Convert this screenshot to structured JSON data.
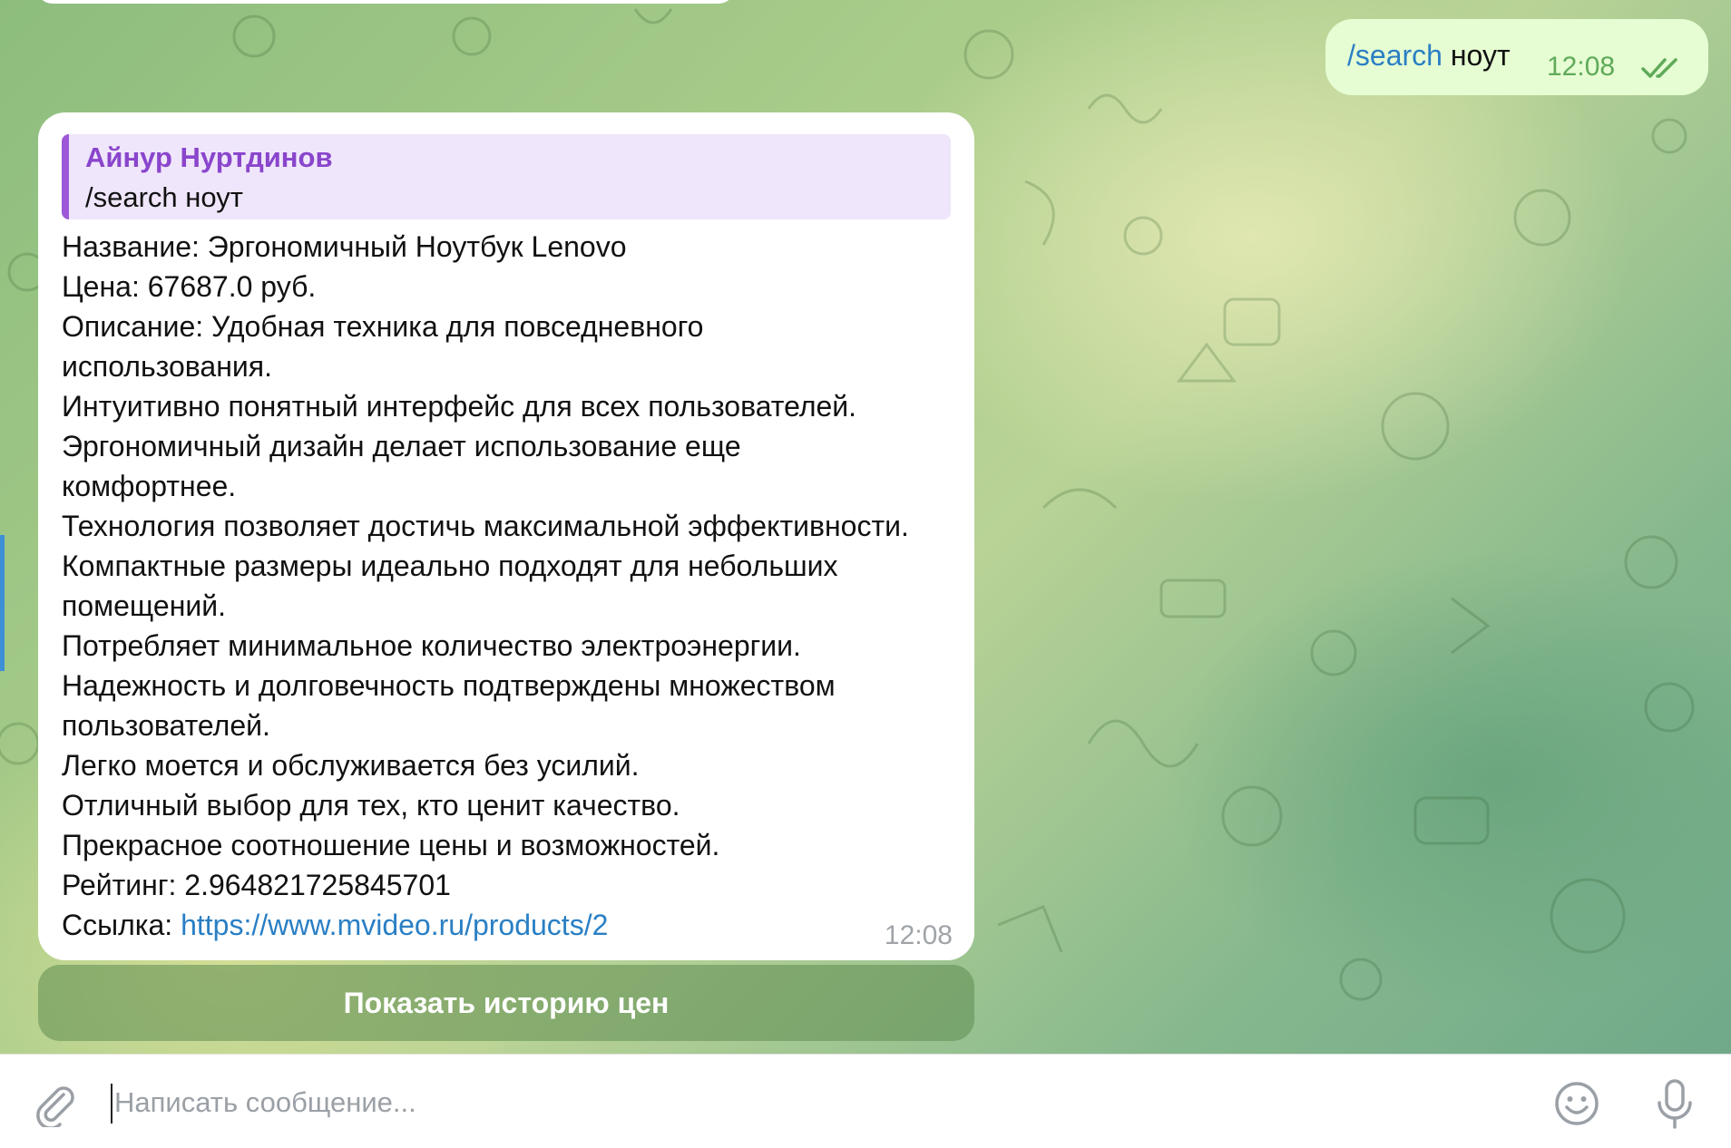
{
  "outgoing_message": {
    "command": "/search",
    "text": "ноут",
    "time": "12:08",
    "status_icon": "double-check-icon"
  },
  "incoming_message": {
    "reply": {
      "author": "Айнур Нуртдинов",
      "text": "/search ноут"
    },
    "lines": [
      "Название: Эргономичный Ноутбук Lenovo",
      "Цена: 67687.0 руб.",
      "Описание: Удобная техника для повседневного",
      "использования.",
      "Интуитивно понятный интерфейс для всех пользователей.",
      "Эргономичный дизайн делает использование еще",
      "комфортнее.",
      "Технология позволяет достичь максимальной эффективности.",
      "Компактные размеры идеально подходят для небольших",
      "помещений.",
      "Потребляет минимальное количество электроэнергии.",
      "Надежность и долговечность подтверждены множеством",
      "пользователей.",
      "Легко моется и обслуживается без усилий.",
      "Отличный выбор для тех, кто ценит качество.",
      "Прекрасное соотношение цены и возможностей.",
      "Рейтинг: 2.964821725845701"
    ],
    "link_label": "Ссылка: ",
    "link_url": "https://www.mvideo.ru/products/2",
    "time": "12:08"
  },
  "inline_button": {
    "label": "Показать историю цен"
  },
  "composer": {
    "placeholder": "Написать сообщение...",
    "value": "",
    "attach_icon": "paperclip-icon",
    "emoji_icon": "smiley-icon",
    "mic_icon": "microphone-icon"
  },
  "colors": {
    "outgoing_bubble": "#e6fcd3",
    "incoming_bubble": "#ffffff",
    "link": "#2a7fc4",
    "reply_accent": "#9b59d8",
    "outgoing_time": "#5faa59"
  }
}
